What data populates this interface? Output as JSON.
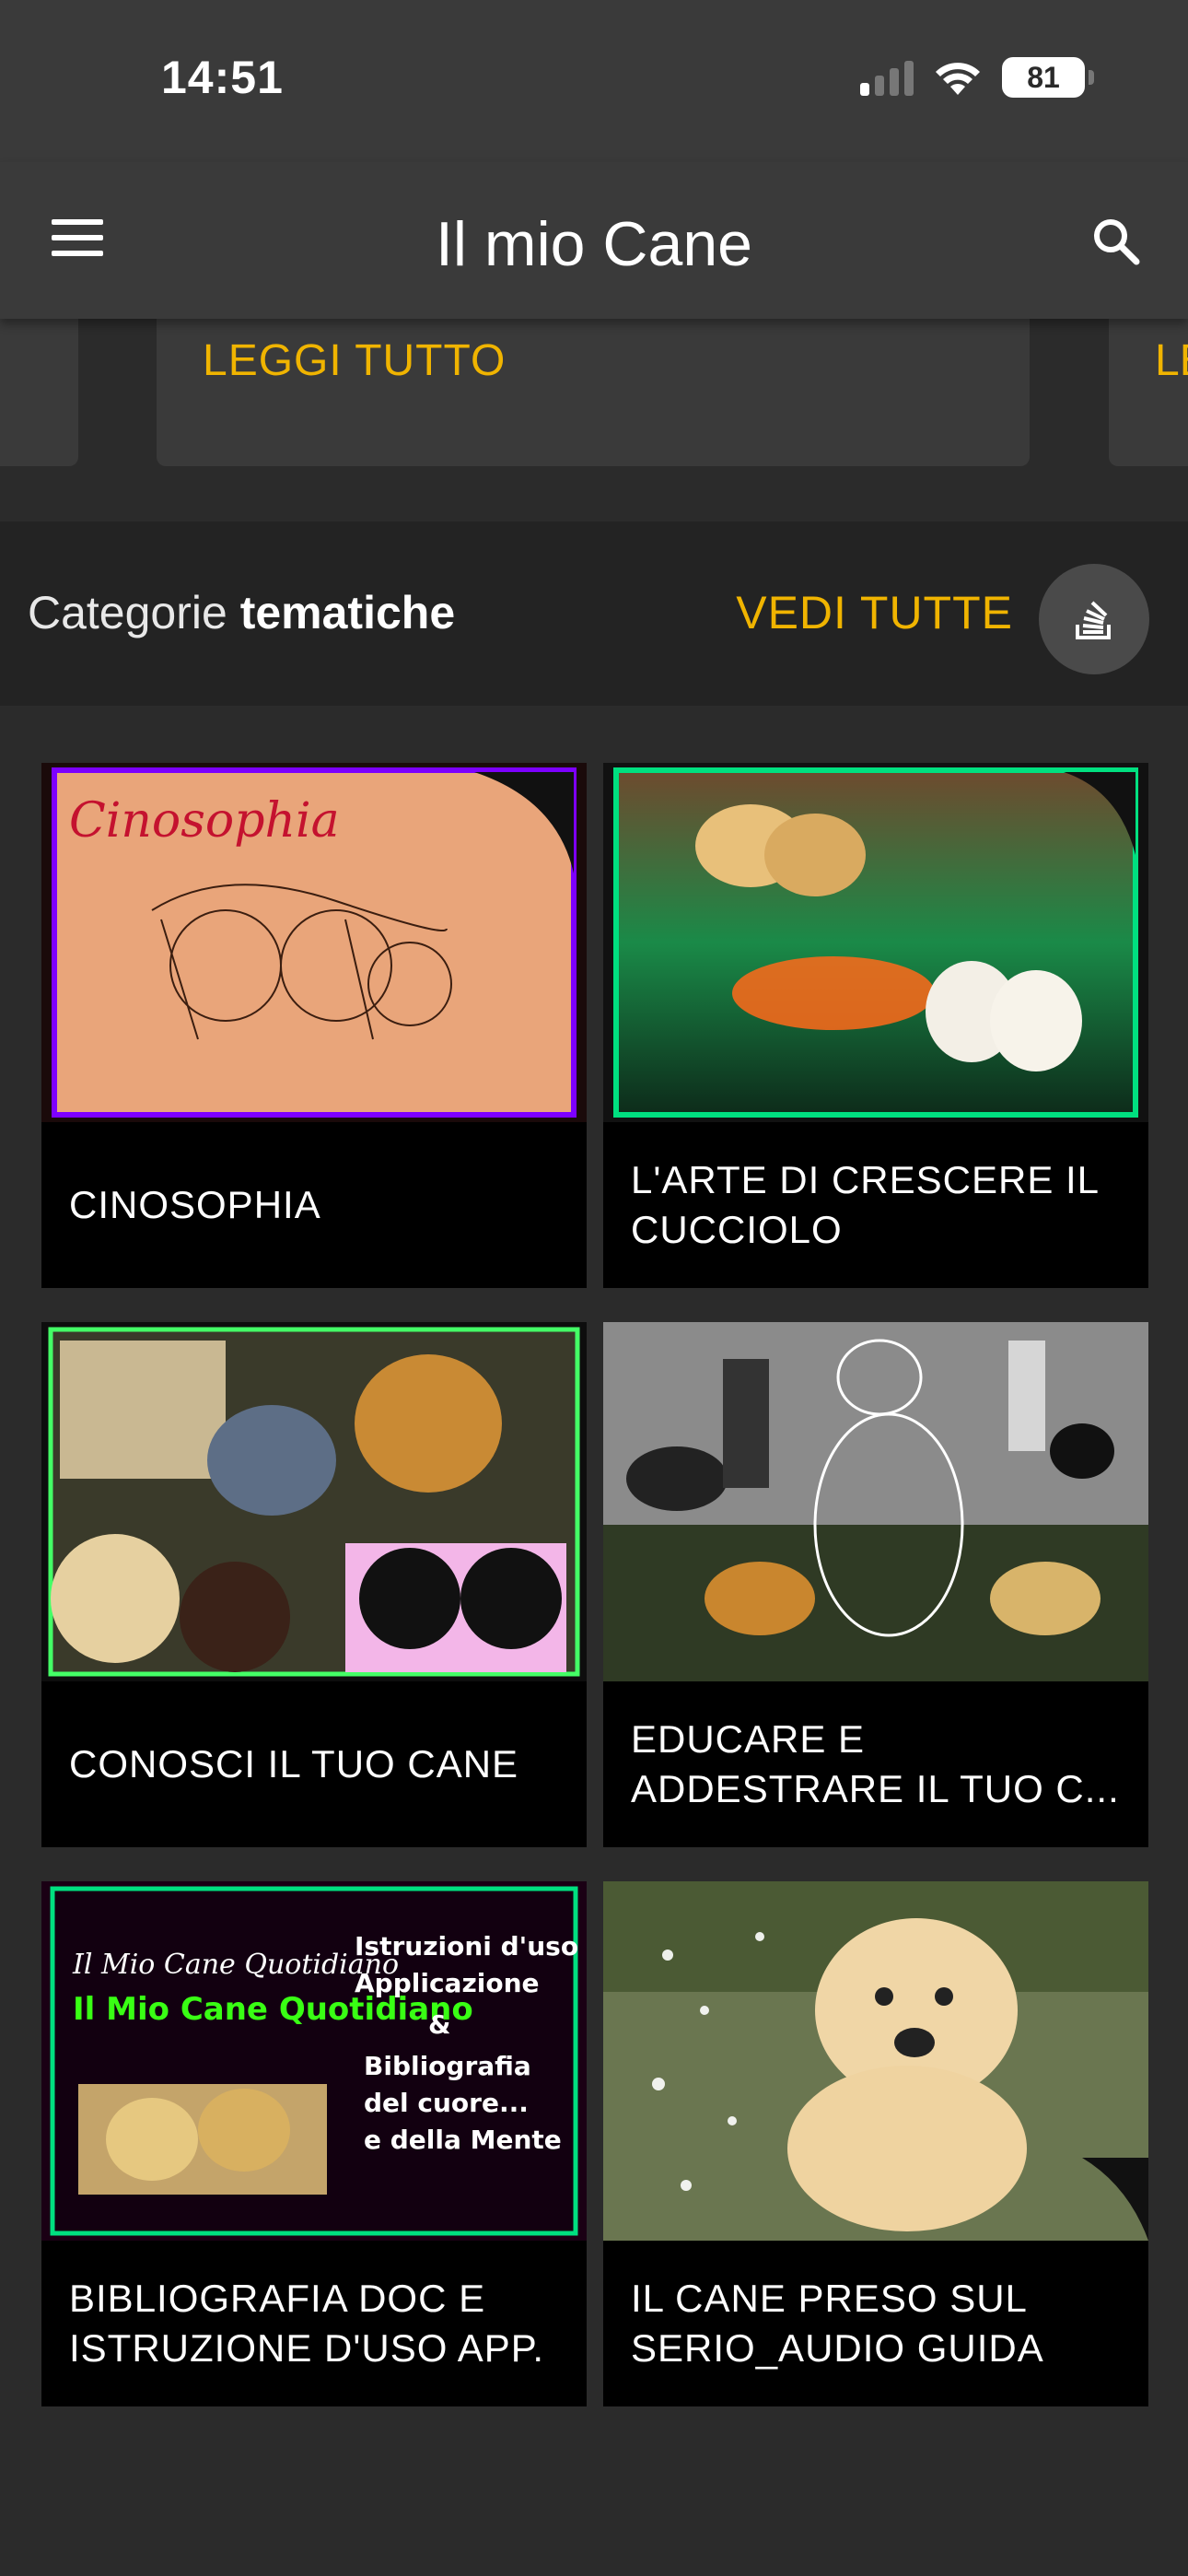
{
  "status": {
    "time": "14:51",
    "battery": "81"
  },
  "app": {
    "title": "Il mio Cane"
  },
  "carousel": {
    "read_more": "LEGGI TUTTO",
    "read_more_peek": "LE"
  },
  "section": {
    "title_light": "Categorie",
    "title_bold": "tematiche",
    "see_all": "VEDI TUTTE"
  },
  "categories": [
    {
      "label": "CINOSOPHIA",
      "thumb_text": "Cinosophia"
    },
    {
      "label": "L'ARTE DI CRESCERE IL CUCCIOLO"
    },
    {
      "label": "CONOSCI IL TUO CANE"
    },
    {
      "label": "EDUCARE E ADDESTRARE IL TUO C..."
    },
    {
      "label": "BIBLIOGRAFIA DOC E ISTRUZIONE D'USO APP.",
      "thumb_text_left": "Il Mio Cane Quotidiano",
      "thumb_text_right": "Istruzioni d'uso Applicazione & Bibliografia del cuore... e della Mente"
    },
    {
      "label": "IL CANE PRESO SUL SERIO_AUDIO GUIDA"
    }
  ],
  "colors": {
    "accent": "#f0b400",
    "appbar": "#3a3a3a",
    "section": "#232323",
    "background": "#2b2b2b"
  },
  "icons": [
    "hamburger-menu-icon",
    "search-icon",
    "stack-overflow-icon",
    "wifi-icon",
    "cellular-signal-icon",
    "battery-icon"
  ]
}
